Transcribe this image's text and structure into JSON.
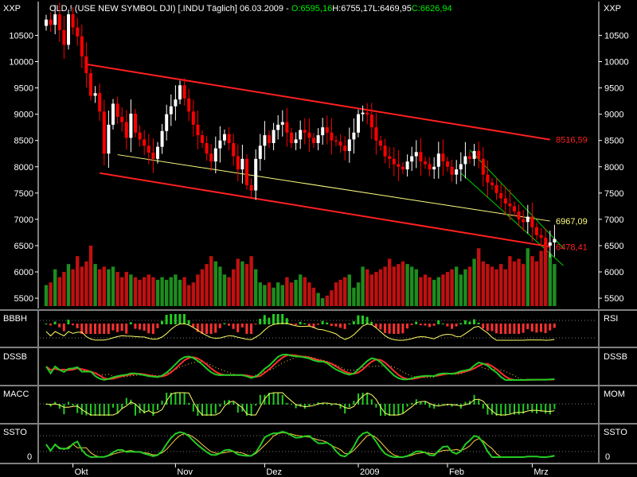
{
  "header": {
    "scale_label_left": "XXP",
    "scale_label_right": "XXP",
    "title": "OLD ! (USE NEW SYMBOL DJI) [.INDU  Täglich] 06.03.2009 - ",
    "open": "O:6595,16",
    "high": "H:6755,17",
    "low": "L:6469,95",
    "close": "C:6626,94"
  },
  "colors": {
    "background": "#000000",
    "axis": "#ffffff",
    "up_candle": "#ffffff",
    "down_candle": "#ff0000",
    "channel": "#ff2020",
    "midline": "#ffff80",
    "recent_channel": "#00cc00",
    "volume_up": "#1e8c1e",
    "volume_down": "#c01010",
    "indicator_green": "#22cc22",
    "indicator_red": "#ff3030",
    "indicator_yellow": "#ffff66"
  },
  "panels": {
    "bbbh": {
      "label_left": "BBBH",
      "label_right": "RSI"
    },
    "dssb": {
      "label_left": "DSSB",
      "label_right": "DSSB"
    },
    "macd": {
      "label_left": "MACC",
      "label_right": "MOM"
    },
    "ssto": {
      "label_left": "SSTO",
      "label_right": "SSTO",
      "tick_left": "0",
      "tick_right": "0"
    }
  },
  "chart_data": {
    "type": "candlestick",
    "ylim": [
      5350,
      10900
    ],
    "y_ticks": [
      "10500",
      "10000",
      "9500",
      "9000",
      "8500",
      "8000",
      "7500",
      "7000",
      "6500",
      "6000",
      "5500"
    ],
    "y_tick_values": [
      10500,
      10000,
      9500,
      9000,
      8500,
      8000,
      7500,
      7000,
      6500,
      6000,
      5500
    ],
    "months": [
      {
        "label": "Okt",
        "index": 6
      },
      {
        "label": "Nov",
        "index": 29
      },
      {
        "label": "Dez",
        "index": 49
      },
      {
        "label": "2009",
        "index": 70
      },
      {
        "label": "Feb",
        "index": 90
      },
      {
        "label": "Mrz",
        "index": 109
      }
    ],
    "annotations": [
      {
        "text": "8516,59",
        "color": "#ff2020",
        "value": 8516.59
      },
      {
        "text": "6967,09",
        "color": "#ffff80",
        "value": 6967.09
      },
      {
        "text": "6478,41",
        "color": "#ff2020",
        "value": 6478.41
      }
    ],
    "lines": {
      "channel_upper": [
        [
          9,
          9950
        ],
        [
          113,
          8516.59
        ]
      ],
      "channel_lower": [
        [
          12,
          7880
        ],
        [
          113,
          6478.41
        ]
      ],
      "midline": [
        [
          16,
          8230
        ],
        [
          113,
          6967.09
        ]
      ],
      "green_upper": [
        [
          95,
          8320
        ],
        [
          116,
          6450
        ]
      ],
      "green_lower": [
        [
          93,
          7880
        ],
        [
          116,
          6120
        ]
      ]
    },
    "close": [
      10800,
      10700,
      10900,
      10600,
      10320,
      10900,
      10650,
      10480,
      10100,
      9780,
      9350,
      9400,
      9050,
      8250,
      8800,
      9200,
      8950,
      8850,
      8550,
      9010,
      8650,
      8520,
      8400,
      8270,
      8150,
      8380,
      8680,
      9000,
      9150,
      9280,
      9550,
      9300,
      9050,
      8800,
      8600,
      8450,
      8250,
      8100,
      8350,
      8500,
      8620,
      8450,
      8200,
      7950,
      8150,
      7650,
      7550,
      8150,
      8400,
      8600,
      8450,
      8700,
      8800,
      8850,
      8650,
      8450,
      8520,
      8700,
      8650,
      8550,
      8450,
      8600,
      8750,
      8650,
      8500,
      8480,
      8400,
      8300,
      8520,
      8650,
      9000,
      9030,
      8990,
      8750,
      8500,
      8400,
      8200,
      8150,
      8050,
      8000,
      7950,
      8100,
      8200,
      8280,
      8100,
      8050,
      7950,
      8000,
      8250,
      8100,
      8000,
      7850,
      7950,
      8050,
      8200,
      8150,
      8300,
      8150,
      7850,
      7700,
      7650,
      7500,
      7400,
      7300,
      7250,
      7150,
      7000,
      6950,
      7050,
      6850,
      6700,
      6650,
      6500,
      6560,
      6627
    ],
    "volume": [
      5750,
      5800,
      6050,
      5900,
      6000,
      6150,
      6050,
      6300,
      6100,
      6200,
      6500,
      6150,
      6050,
      6100,
      6050,
      6100,
      6000,
      5900,
      6000,
      5950,
      5900,
      5850,
      5900,
      5950,
      5900,
      5850,
      5900,
      5850,
      5900,
      5950,
      5850,
      5900,
      5750,
      5800,
      5950,
      6050,
      6150,
      6300,
      6200,
      6100,
      5950,
      5900,
      6050,
      6250,
      6200,
      6150,
      6300,
      6050,
      5800,
      5750,
      5800,
      5700,
      5800,
      5750,
      5900,
      5800,
      5850,
      5950,
      5900,
      5800,
      5700,
      5600,
      5500,
      5550,
      5650,
      5800,
      5850,
      5900,
      5950,
      5700,
      5800,
      6100,
      6050,
      5950,
      6000,
      6050,
      6100,
      6250,
      6100,
      6150,
      6200,
      6150,
      6100,
      6050,
      5900,
      5950,
      5900,
      5850,
      5900,
      5950,
      6000,
      6050,
      6100,
      5950,
      6050,
      6100,
      6250,
      6450,
      6200,
      6150,
      6100,
      6050,
      6150,
      6050,
      6300,
      6200,
      6250,
      6150,
      6450,
      6300,
      6200,
      6400,
      6550,
      6350,
      6150
    ]
  }
}
